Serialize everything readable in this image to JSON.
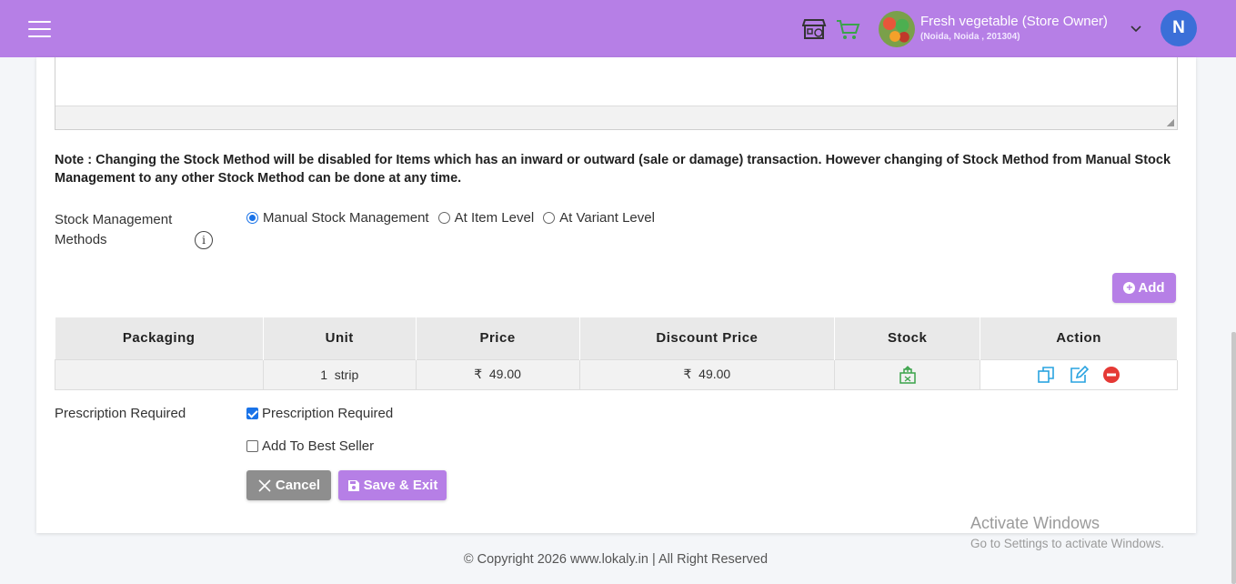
{
  "header": {
    "store_name": "Fresh vegetable (Store Owner)",
    "store_address": "(Noida, Noida , 201304)",
    "user_initial": "N",
    "icons": [
      "menu-icon",
      "store-icon",
      "cart-icon",
      "chevron-down-icon"
    ]
  },
  "note": "Note : Changing the Stock Method will be disabled for Items which has an inward or outward (sale or damage) transaction. However changing of Stock Method from Manual Stock Management to any other Stock Method can be done at any time.",
  "stock_methods": {
    "label": "Stock Management Methods",
    "info_icon": "i",
    "options": [
      {
        "label": "Manual Stock Management",
        "checked": true
      },
      {
        "label": "At Item Level",
        "checked": false
      },
      {
        "label": "At Variant Level",
        "checked": false
      }
    ]
  },
  "add_button": {
    "label": "Add"
  },
  "table": {
    "headers": [
      "Packaging",
      "Unit",
      "Price",
      "Discount Price",
      "Stock",
      "Action"
    ],
    "rows": [
      {
        "packaging": "",
        "unit": "1  strip",
        "price": "₹  49.00",
        "discount_price": "₹  49.00",
        "stock_icon": "stock-box-icon",
        "actions": [
          "copy-icon",
          "edit-icon",
          "remove-icon"
        ]
      }
    ]
  },
  "prescription": {
    "label": "Prescription Required",
    "required_label": "Prescription Required",
    "required_checked": true,
    "best_seller_label": "Add To Best Seller",
    "best_seller_checked": false
  },
  "buttons": {
    "cancel": "Cancel",
    "save_exit": "Save & Exit"
  },
  "watermark": {
    "title": "Activate Windows",
    "subtitle": "Go to Settings to activate Windows."
  },
  "footer": "© Copyright 2026 www.lokaly.in | All Right Reserved",
  "colors": {
    "brand": "#b67fe6",
    "avatar": "#3b6fd8",
    "checked": "#1a73e8",
    "remove": "#e53935",
    "action_icon": "#29a3e0",
    "stock_icon": "#3aa34a"
  }
}
